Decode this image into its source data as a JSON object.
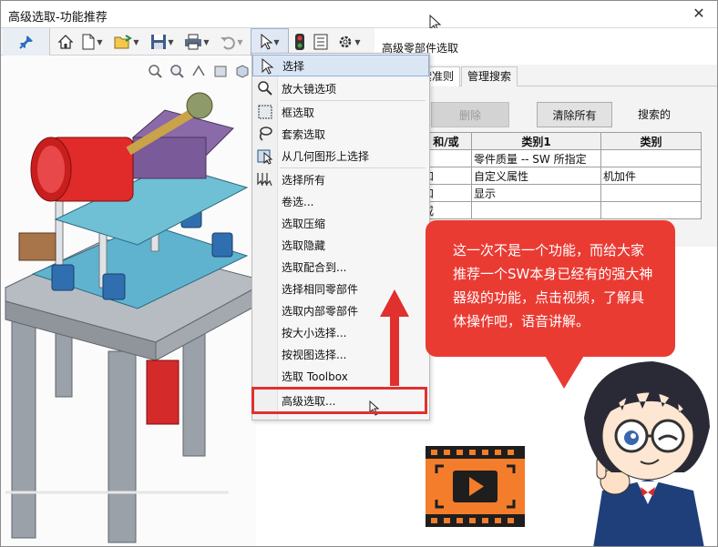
{
  "window": {
    "title": "高级选取-功能推荐",
    "close_icon": "close-icon"
  },
  "toolbar": {
    "icons": [
      "pin-icon",
      "home-icon",
      "new-document-icon",
      "open-folder-icon",
      "save-icon",
      "print-icon",
      "undo-icon",
      "select-arrow-icon",
      "traffic-light-icon",
      "file-properties-icon",
      "gear-icon"
    ]
  },
  "viewport": {
    "icons": [
      "zoom-to-fit-icon",
      "zoom-area-icon",
      "previous-view-icon",
      "section-view-icon",
      "view-orientation-icon"
    ]
  },
  "menu": {
    "items": [
      {
        "label": "选择",
        "icon": "select-arrow-icon"
      },
      {
        "label": "放大镜选项",
        "icon": "magnifier-icon"
      },
      {
        "label": "框选取",
        "icon": "box-select-icon"
      },
      {
        "label": "套索选取",
        "icon": "lasso-icon"
      },
      {
        "label": "从几何图形上选择",
        "icon": "geometry-select-icon"
      },
      {
        "label": "选择所有",
        "icon": "select-all-icon"
      },
      {
        "label": "卷选...",
        "icon": ""
      },
      {
        "label": "选取压缩",
        "icon": ""
      },
      {
        "label": "选取隐藏",
        "icon": ""
      },
      {
        "label": "选取配合到...",
        "icon": ""
      },
      {
        "label": "选择相同零部件",
        "icon": ""
      },
      {
        "label": "选取内部零部件",
        "icon": ""
      },
      {
        "label": "按大小选择...",
        "icon": ""
      },
      {
        "label": "按视图选择...",
        "icon": ""
      },
      {
        "label": "选取 Toolbox",
        "icon": ""
      },
      {
        "label": "高级选取...",
        "icon": ""
      }
    ]
  },
  "panel": {
    "title": "高级零部件选取",
    "tabs": [
      "指定搜索准则",
      "管理搜索"
    ],
    "delete_label": "删除",
    "clear_label": "清除所有",
    "search_label": "搜索的",
    "columns": [
      "",
      "和/或",
      "类别1",
      "类别"
    ],
    "rows": [
      {
        "num": "1",
        "op": "",
        "cat1": "零件质量 -- SW 所指定",
        "cat2": ""
      },
      {
        "num": "2",
        "op": "和",
        "cat1": "自定义属性",
        "cat2": "机加件"
      },
      {
        "num": "3",
        "op": "和",
        "cat1": "显示",
        "cat2": ""
      },
      {
        "num": "4",
        "op": "或",
        "cat1": "",
        "cat2": ""
      }
    ]
  },
  "callout": {
    "text": "这一次不是一个功能，而给大家推荐一个SW本身已经有的强大神器级的功能，点击视频，了解具体操作吧，语音讲解。",
    "color": "#ea3b33"
  },
  "video": {
    "icon": "video-play-icon",
    "color": "#f37d2b"
  },
  "colors": {
    "highlight_red": "#e0312e",
    "menu_highlight": "#dbe6f5"
  }
}
